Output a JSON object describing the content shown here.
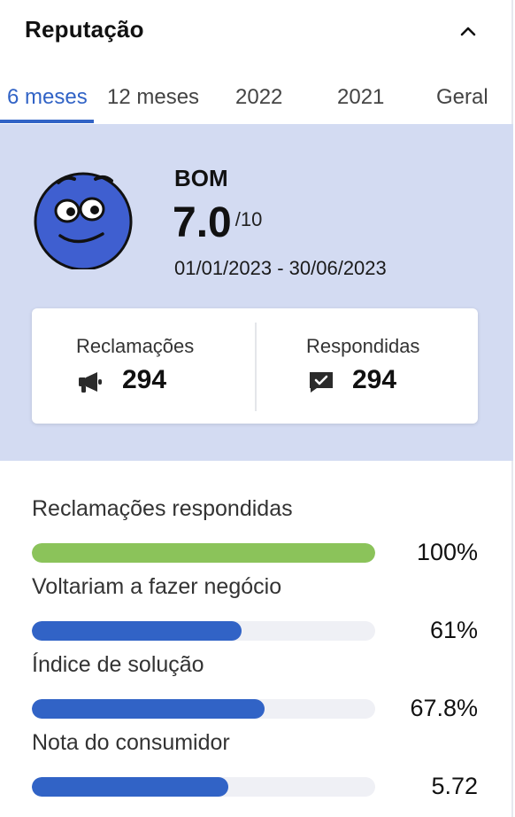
{
  "header": {
    "title": "Reputação"
  },
  "tabs": [
    {
      "label": "6 meses",
      "active": true
    },
    {
      "label": "12 meses",
      "active": false
    },
    {
      "label": "2022",
      "active": false
    },
    {
      "label": "2021",
      "active": false
    },
    {
      "label": "Geral",
      "active": false
    }
  ],
  "score": {
    "rating": "BOM",
    "value": "7.0",
    "max": "/10",
    "date_range": "01/01/2023 - 30/06/2023"
  },
  "stats": {
    "complaints_label": "Reclamações",
    "complaints_value": "294",
    "answered_label": "Respondidas",
    "answered_value": "294"
  },
  "metrics": [
    {
      "label": "Reclamações respondidas",
      "value": "100%",
      "fraction": 1.0,
      "color": "#8bc35a"
    },
    {
      "label": "Voltariam a fazer negócio",
      "value": "61%",
      "fraction": 0.61,
      "color": "#3163c6"
    },
    {
      "label": "Índice de solução",
      "value": "67.8%",
      "fraction": 0.678,
      "color": "#3163c6"
    },
    {
      "label": "Nota do consumidor",
      "value": "5.72",
      "fraction": 0.572,
      "color": "#3163c6"
    }
  ],
  "colors": {
    "accent": "#3163c6",
    "score_background": "#d3dbf2",
    "face": "#3f5fd0"
  }
}
